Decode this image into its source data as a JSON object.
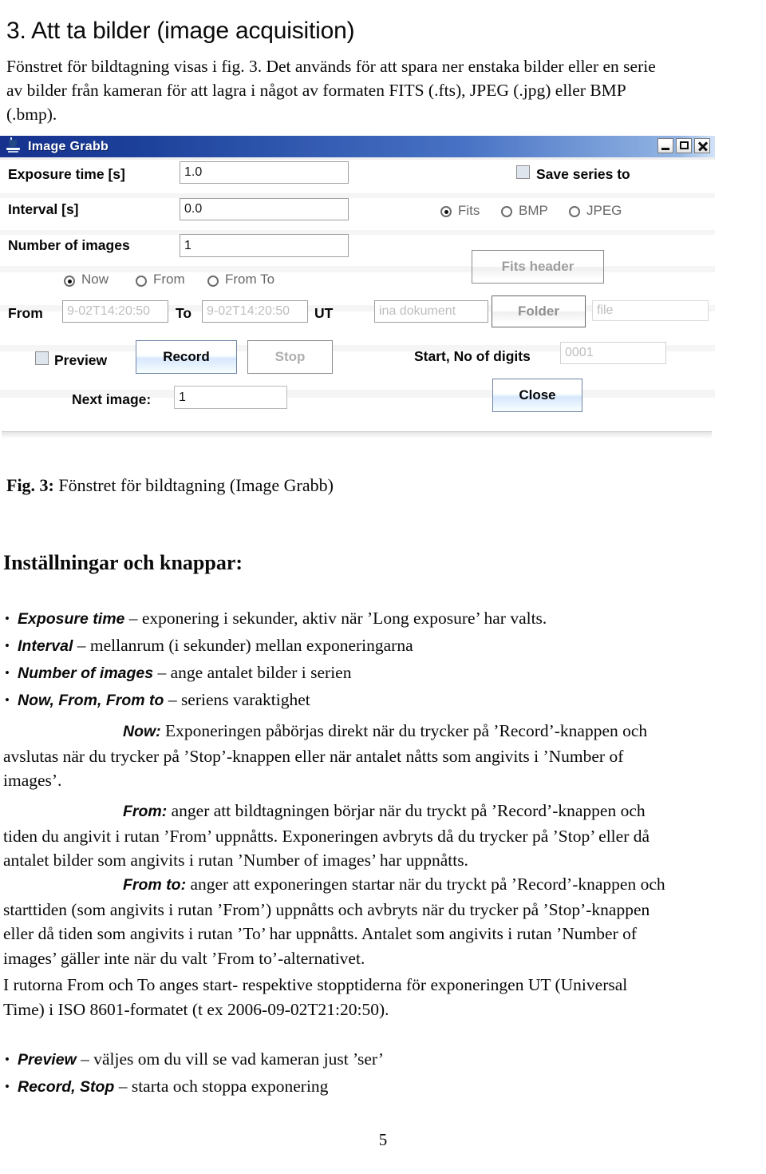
{
  "document": {
    "heading": "3. Att ta bilder (image acquisition)",
    "intro_lines": [
      "Fönstret för bildtagning visas i fig. 3. Det används för att spara ner enstaka bilder eller en serie",
      "av bilder från kameran för att lagra i något av formaten FITS (.fts), JPEG (.jpg) eller BMP",
      "(.bmp)."
    ],
    "figure_caption_label": "Fig. 3:",
    "figure_caption_text": " Fönstret för bildtagning (Image Grabb)",
    "section_heading": "Inställningar och knappar:",
    "page_number": "5"
  },
  "figure": {
    "window": {
      "title": "Image Grabb",
      "icon": "coffee-cup-icon",
      "minimize_label": "_",
      "maximize_label": "□",
      "close_label": "×"
    },
    "labels": {
      "exposure_time": "Exposure time [s]",
      "interval": "Interval [s]",
      "number_of_images": "Number of images",
      "from": "From",
      "to": "To",
      "ut": "UT",
      "preview": "Preview",
      "next_image": "Next image:",
      "save_series_to": "Save series to",
      "start_no_of_digits": "Start, No of digits"
    },
    "fields": {
      "exposure_time_value": "1.0",
      "interval_value": "0.0",
      "number_of_images_value": "1",
      "from_value": "9-02T14:20:50",
      "to_value": "9-02T14:20:50",
      "next_image_value": "1",
      "folder_path_value": "ina dokument",
      "file_value": "file",
      "digits_value": "0001"
    },
    "radios_time": [
      {
        "label": "Now",
        "selected": true
      },
      {
        "label": "From",
        "selected": false
      },
      {
        "label": "From To",
        "selected": false
      }
    ],
    "radios_format": [
      {
        "label": "Fits",
        "selected": true
      },
      {
        "label": "BMP",
        "selected": false
      },
      {
        "label": "JPEG",
        "selected": false
      }
    ],
    "buttons": {
      "fits_header": "Fits header",
      "folder": "Folder",
      "record": "Record",
      "stop": "Stop",
      "close": "Close"
    },
    "checkboxes": {
      "save_series_to_checked": false,
      "preview_checked": false
    },
    "colors": {
      "titlebar_start": "#1f3a93",
      "titlebar_end": "#c9d9ee",
      "window_bg": "#f2f2f2",
      "field_bg": "#fbfbfb",
      "accent_button": "#cddcf0"
    }
  },
  "bullets": [
    {
      "term": "Exposure time",
      "rest": " – exponering i sekunder, aktiv när ’Long exposure’ har valts."
    },
    {
      "term": "Interval",
      "rest": " – mellanrum (i sekunder) mellan exponeringarna"
    },
    {
      "term": "Number of images",
      "rest": " – ange antalet bilder i serien"
    },
    {
      "term": "Now, From, From to",
      "rest": " – seriens varaktighet"
    }
  ],
  "bullets2": [
    {
      "term": "Preview",
      "rest": " – väljes om du vill se vad kameran just ’ser’"
    },
    {
      "term": "Record, Stop",
      "rest": " – starta och stoppa exponering"
    }
  ],
  "paragraphs": {
    "now": {
      "term": "Now:",
      "lines": [
        " Exponeringen påbörjas direkt när du trycker på ’Record’-knappen och",
        "avslutas när du trycker på ’Stop’-knappen eller när antalet nåtts som angivits i ’Number of",
        "images’."
      ]
    },
    "from": {
      "term": "From:",
      "lines": [
        " anger att bildtagningen börjar när du tryckt på ’Record’-knappen och",
        "tiden du angivit i rutan ’From’ uppnåtts. Exponeringen avbryts då du trycker på ’Stop’ eller då",
        "antalet bilder som angivits i rutan ’Number of images’ har uppnåtts."
      ]
    },
    "fromto": {
      "term": "From to:",
      "lines": [
        " anger att exponeringen startar när du tryckt på ’Record’-knappen och",
        "starttiden (som angivits i rutan ’From’) uppnåtts och avbryts när du trycker på ’Stop’-knappen",
        "eller då tiden som angivits i rutan ’To’ har uppnåtts. Antalet som angivits i rutan ’Number of",
        "images’ gäller inte när du valt ’From to’-alternativet."
      ]
    },
    "ut": {
      "lines": [
        "I rutorna From och To anges start- respektive stopptiderna för exponeringen UT (Universal",
        "Time) i ISO 8601-formatet (t ex 2006-09-02T21:20:50)."
      ]
    }
  }
}
